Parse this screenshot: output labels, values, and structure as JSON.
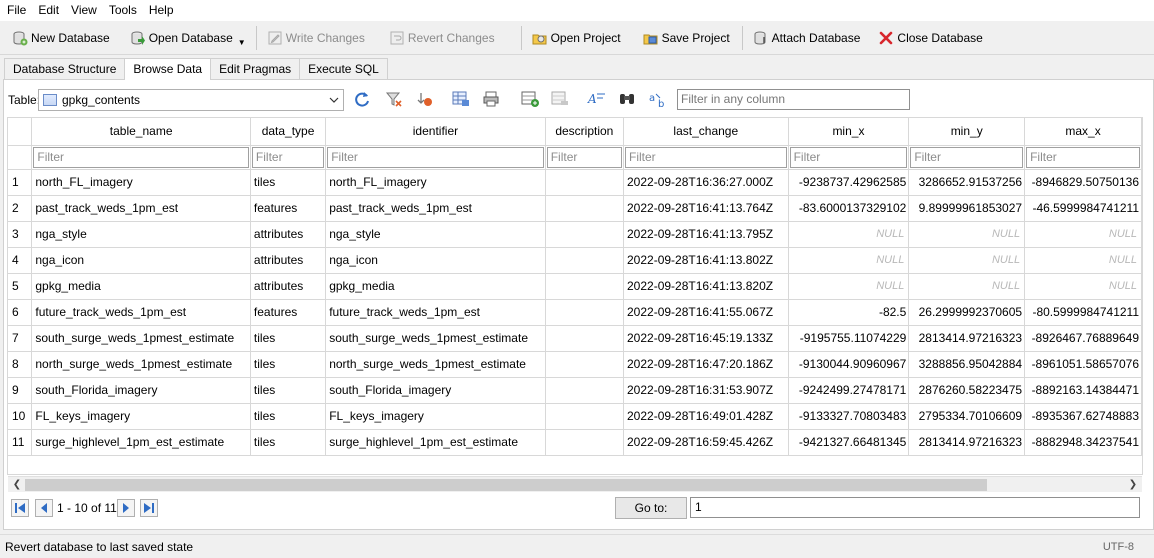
{
  "menu": [
    "File",
    "Edit",
    "View",
    "Tools",
    "Help"
  ],
  "toolbar": {
    "new_database": "New Database",
    "open_database": "Open Database",
    "write_changes": "Write Changes",
    "revert_changes": "Revert Changes",
    "open_project": "Open Project",
    "save_project": "Save Project",
    "attach_database": "Attach Database",
    "close_database": "Close Database"
  },
  "tabs": [
    "Database Structure",
    "Browse Data",
    "Edit Pragmas",
    "Execute SQL"
  ],
  "active_tab": "Browse Data",
  "table_label": "Table:",
  "table_selected": "gpkg_contents",
  "filter_all_placeholder": "Filter in any column",
  "columns": [
    "table_name",
    "data_type",
    "identifier",
    "description",
    "last_change",
    "min_x",
    "min_y",
    "max_x"
  ],
  "filter_placeholder": "Filter",
  "null_text": "NULL",
  "rows": [
    {
      "n": "1",
      "table_name": "north_FL_imagery",
      "data_type": "tiles",
      "identifier": "north_FL_imagery",
      "description": "",
      "last_change": "2022-09-28T16:36:27.000Z",
      "min_x": "-9238737.42962585",
      "min_y": "3286652.91537256",
      "max_x": "-8946829.50750136"
    },
    {
      "n": "2",
      "table_name": "past_track_weds_1pm_est",
      "data_type": "features",
      "identifier": "past_track_weds_1pm_est",
      "description": "",
      "last_change": "2022-09-28T16:41:13.764Z",
      "min_x": "-83.6000137329102",
      "min_y": "9.89999961853027",
      "max_x": "-46.5999984741211"
    },
    {
      "n": "3",
      "table_name": "nga_style",
      "data_type": "attributes",
      "identifier": "nga_style",
      "description": "",
      "last_change": "2022-09-28T16:41:13.795Z",
      "min_x": null,
      "min_y": null,
      "max_x": null
    },
    {
      "n": "4",
      "table_name": "nga_icon",
      "data_type": "attributes",
      "identifier": "nga_icon",
      "description": "",
      "last_change": "2022-09-28T16:41:13.802Z",
      "min_x": null,
      "min_y": null,
      "max_x": null
    },
    {
      "n": "5",
      "table_name": "gpkg_media",
      "data_type": "attributes",
      "identifier": "gpkg_media",
      "description": "",
      "last_change": "2022-09-28T16:41:13.820Z",
      "min_x": null,
      "min_y": null,
      "max_x": null
    },
    {
      "n": "6",
      "table_name": "future_track_weds_1pm_est",
      "data_type": "features",
      "identifier": "future_track_weds_1pm_est",
      "description": "",
      "last_change": "2022-09-28T16:41:55.067Z",
      "min_x": "-82.5",
      "min_y": "26.2999992370605",
      "max_x": "-80.5999984741211"
    },
    {
      "n": "7",
      "table_name": "south_surge_weds_1pmest_estimate",
      "data_type": "tiles",
      "identifier": "south_surge_weds_1pmest_estimate",
      "description": "",
      "last_change": "2022-09-28T16:45:19.133Z",
      "min_x": "-9195755.11074229",
      "min_y": "2813414.97216323",
      "max_x": "-8926467.76889649"
    },
    {
      "n": "8",
      "table_name": "north_surge_weds_1pmest_estimate",
      "data_type": "tiles",
      "identifier": "north_surge_weds_1pmest_estimate",
      "description": "",
      "last_change": "2022-09-28T16:47:20.186Z",
      "min_x": "-9130044.90960967",
      "min_y": "3288856.95042884",
      "max_x": "-8961051.58657076"
    },
    {
      "n": "9",
      "table_name": "south_Florida_imagery",
      "data_type": "tiles",
      "identifier": "south_Florida_imagery",
      "description": "",
      "last_change": "2022-09-28T16:31:53.907Z",
      "min_x": "-9242499.27478171",
      "min_y": "2876260.58223475",
      "max_x": "-8892163.14384471"
    },
    {
      "n": "10",
      "table_name": "FL_keys_imagery",
      "data_type": "tiles",
      "identifier": "FL_keys_imagery",
      "description": "",
      "last_change": "2022-09-28T16:49:01.428Z",
      "min_x": "-9133327.70803483",
      "min_y": "2795334.70106609",
      "max_x": "-8935367.62748883"
    },
    {
      "n": "11",
      "table_name": "surge_highlevel_1pm_est_estimate",
      "data_type": "tiles",
      "identifier": "surge_highlevel_1pm_est_estimate",
      "description": "",
      "last_change": "2022-09-28T16:59:45.426Z",
      "min_x": "-9421327.66481345",
      "min_y": "2813414.97216323",
      "max_x": "-8882948.34237541"
    }
  ],
  "nav": {
    "range": "1 - 10 of 11",
    "goto_label": "Go to:",
    "goto_value": "1"
  },
  "status": {
    "message": "Revert database to last saved state",
    "encoding": "UTF-8"
  }
}
